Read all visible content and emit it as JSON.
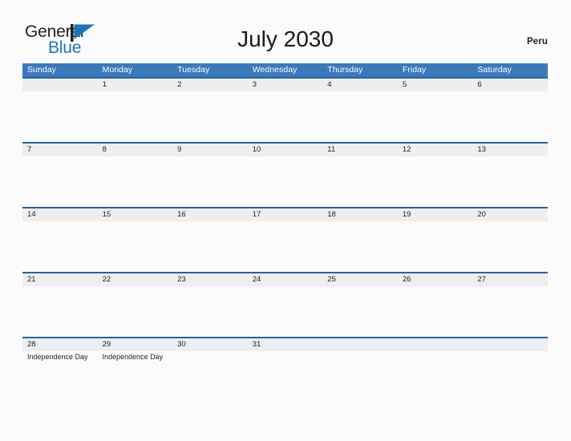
{
  "brand": {
    "name_part1": "General",
    "name_part2": "Blue",
    "flag_icon": "blue-triangle-flag-icon",
    "color_dark": "#231f20",
    "color_blue": "#1b75bb"
  },
  "header": {
    "title": "July 2030",
    "country": "Peru"
  },
  "theme": {
    "header_blue": "#3b79bd",
    "row_border_blue": "#1f64a8",
    "row_band_gray": "#eeeeee",
    "page_background": "#fbfbfb",
    "text_dark": "#222222"
  },
  "calendar": {
    "month": "July",
    "year": "2030",
    "weekday_headers": [
      "Sunday",
      "Monday",
      "Tuesday",
      "Wednesday",
      "Thursday",
      "Friday",
      "Saturday"
    ],
    "weeks": [
      {
        "days": [
          {
            "number": "",
            "event": ""
          },
          {
            "number": "1",
            "event": ""
          },
          {
            "number": "2",
            "event": ""
          },
          {
            "number": "3",
            "event": ""
          },
          {
            "number": "4",
            "event": ""
          },
          {
            "number": "5",
            "event": ""
          },
          {
            "number": "6",
            "event": ""
          }
        ]
      },
      {
        "days": [
          {
            "number": "7",
            "event": ""
          },
          {
            "number": "8",
            "event": ""
          },
          {
            "number": "9",
            "event": ""
          },
          {
            "number": "10",
            "event": ""
          },
          {
            "number": "11",
            "event": ""
          },
          {
            "number": "12",
            "event": ""
          },
          {
            "number": "13",
            "event": ""
          }
        ]
      },
      {
        "days": [
          {
            "number": "14",
            "event": ""
          },
          {
            "number": "15",
            "event": ""
          },
          {
            "number": "16",
            "event": ""
          },
          {
            "number": "17",
            "event": ""
          },
          {
            "number": "18",
            "event": ""
          },
          {
            "number": "19",
            "event": ""
          },
          {
            "number": "20",
            "event": ""
          }
        ]
      },
      {
        "days": [
          {
            "number": "21",
            "event": ""
          },
          {
            "number": "22",
            "event": ""
          },
          {
            "number": "23",
            "event": ""
          },
          {
            "number": "24",
            "event": ""
          },
          {
            "number": "25",
            "event": ""
          },
          {
            "number": "26",
            "event": ""
          },
          {
            "number": "27",
            "event": ""
          }
        ]
      },
      {
        "days": [
          {
            "number": "28",
            "event": "Independence Day"
          },
          {
            "number": "29",
            "event": "Independence Day"
          },
          {
            "number": "30",
            "event": ""
          },
          {
            "number": "31",
            "event": ""
          },
          {
            "number": "",
            "event": ""
          },
          {
            "number": "",
            "event": ""
          },
          {
            "number": "",
            "event": ""
          }
        ]
      }
    ]
  }
}
